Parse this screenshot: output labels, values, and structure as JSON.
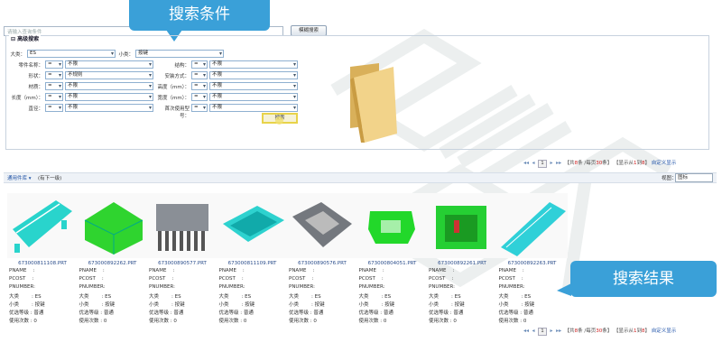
{
  "search": {
    "placeholder": "请输入查询条件",
    "fuzzy_label": "模糊搜索"
  },
  "callouts": {
    "top": "搜索条件",
    "bottom": "搜索结果"
  },
  "advanced": {
    "title": "高级搜索",
    "major_label": "大类：",
    "major_value": "ES",
    "minor_label": "小类：",
    "minor_value": "按键",
    "rows": [
      {
        "left_label": "零件名称：",
        "left_op": "=",
        "left_val": "不限",
        "right_label": "结构：",
        "right_op": "=",
        "right_val": "不限"
      },
      {
        "left_label": "形状：",
        "left_op": "=",
        "left_val": "不规则",
        "right_label": "安装方式：",
        "right_op": "=",
        "right_val": "不限"
      },
      {
        "left_label": "材质：",
        "left_op": "=",
        "left_val": "不限",
        "right_label": "高度（mm）：",
        "right_op": "=",
        "right_val": "不限"
      },
      {
        "left_label": "长度（mm）：",
        "left_op": "=",
        "left_val": "不限",
        "right_label": "宽度（mm）：",
        "right_op": "=",
        "right_val": "不限"
      },
      {
        "left_label": "直径：",
        "left_op": "=",
        "left_val": "不限",
        "right_label": "首次使用型号：",
        "right_op": "=",
        "right_val": "不限"
      }
    ],
    "search_btn": "搜索"
  },
  "pager": {
    "first": "◂◂",
    "prev": "◂",
    "page": "1",
    "next": "▸",
    "last": "▸▸",
    "total_pre": "【共",
    "total": "8",
    "total_mid": "条 /每页",
    "per_page": "30",
    "total_post": "条】",
    "range_pre": "【显示从",
    "range_from": "1",
    "range_mid": "到",
    "range_to": "8",
    "range_post": "】",
    "custom": "自定义显示"
  },
  "results_bar": {
    "library": "通用件库 ▾",
    "hint": "(有下一级)",
    "view_label": "视图：",
    "view_value": "图标"
  },
  "results": [
    {
      "name": "673000811108.PRT",
      "color": "#29d4cc",
      "shape": "rail"
    },
    {
      "name": "673000892262.PRT",
      "color": "#2fd42f",
      "shape": "box"
    },
    {
      "name": "673000890577.PRT",
      "color": "#8a8f96",
      "shape": "comb"
    },
    {
      "name": "673000811109.PRT",
      "color": "#2ed2cf",
      "shape": "tray"
    },
    {
      "name": "673000890576.PRT",
      "color": "#74787e",
      "shape": "bracket"
    },
    {
      "name": "673000804051.PRT",
      "color": "#22d82a",
      "shape": "clip"
    },
    {
      "name": "673000892261.PRT",
      "color": "#25cf33",
      "shape": "frame"
    },
    {
      "name": "673000892263.PRT",
      "color": "#2fd0d8",
      "shape": "bar"
    }
  ],
  "fields": {
    "pname": "PNAME    :",
    "pcost": "PCOST    :",
    "pnumber": "PNUMBER:",
    "major": "大类        : ES",
    "minor": "小类        : 按键",
    "level": "优选等级 : 普通",
    "usage": "使用次数 : 0"
  }
}
